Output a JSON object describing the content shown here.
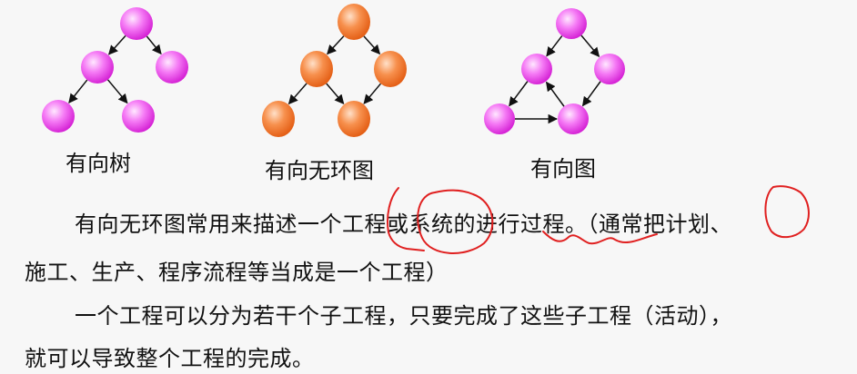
{
  "graphs": [
    {
      "caption": "有向树",
      "node_style": "pink",
      "nodes": [
        "A",
        "B",
        "C",
        "D",
        "E"
      ],
      "edges": [
        [
          "A",
          "B"
        ],
        [
          "A",
          "C"
        ],
        [
          "B",
          "D"
        ],
        [
          "B",
          "E"
        ]
      ]
    },
    {
      "caption": "有向无环图",
      "node_style": "orange",
      "nodes": [
        "A",
        "B",
        "C",
        "D",
        "E"
      ],
      "edges": [
        [
          "A",
          "B"
        ],
        [
          "A",
          "C"
        ],
        [
          "B",
          "D"
        ],
        [
          "B",
          "E"
        ],
        [
          "C",
          "E"
        ]
      ]
    },
    {
      "caption": "有向图",
      "node_style": "pink",
      "nodes": [
        "A",
        "B",
        "C",
        "D",
        "E"
      ],
      "edges": [
        [
          "A",
          "B"
        ],
        [
          "A",
          "C"
        ],
        [
          "C",
          "E"
        ],
        [
          "E",
          "B"
        ],
        [
          "B",
          "D"
        ],
        [
          "D",
          "E"
        ]
      ]
    }
  ],
  "colors": {
    "pink": "#ee33ee",
    "orange": "#f06010",
    "annotation": "#e02020"
  },
  "text": {
    "line1": "有向无环图常用来描述一个工程或系统的进行过程。（通常把计划、",
    "line2": "施工、生产、程序流程等当成是一个工程）",
    "line3": "一个工程可以分为若干个子工程，只要完成了这些子工程（活动），",
    "line4": "就可以导致整个工程的完成。"
  }
}
